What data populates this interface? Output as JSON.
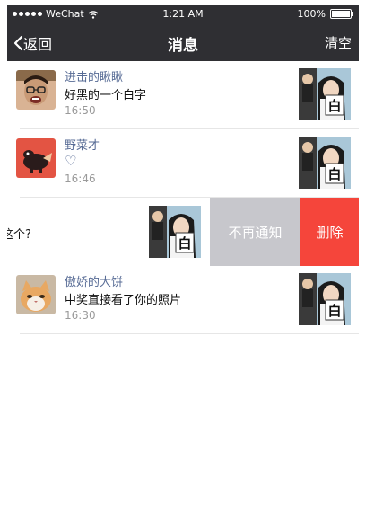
{
  "status_bar": {
    "carrier": "WeChat",
    "time": "1:21 AM",
    "battery": "100%",
    "battery_level": 1.0
  },
  "nav": {
    "back_label": "返回",
    "title": "消息",
    "clear_label": "清空"
  },
  "messages": [
    {
      "name": "进击的瞅瞅",
      "content": "好黑的一个白字",
      "time": "16:50"
    },
    {
      "name": "野菜才",
      "content": "♡",
      "time": "16:46"
    },
    {
      "content": "这个?"
    },
    {
      "name": "傲娇的大饼",
      "content": "中奖直接看了你的照片",
      "time": "16:30"
    }
  ],
  "swipe_actions": {
    "mute_label": "不再通知",
    "delete_label": "删除"
  },
  "thumbnail_sign_text": "白",
  "colors": {
    "bar": "#2f2f33",
    "name": "#576b95",
    "delete": "#f5453b",
    "mute": "#c7c7cc"
  }
}
